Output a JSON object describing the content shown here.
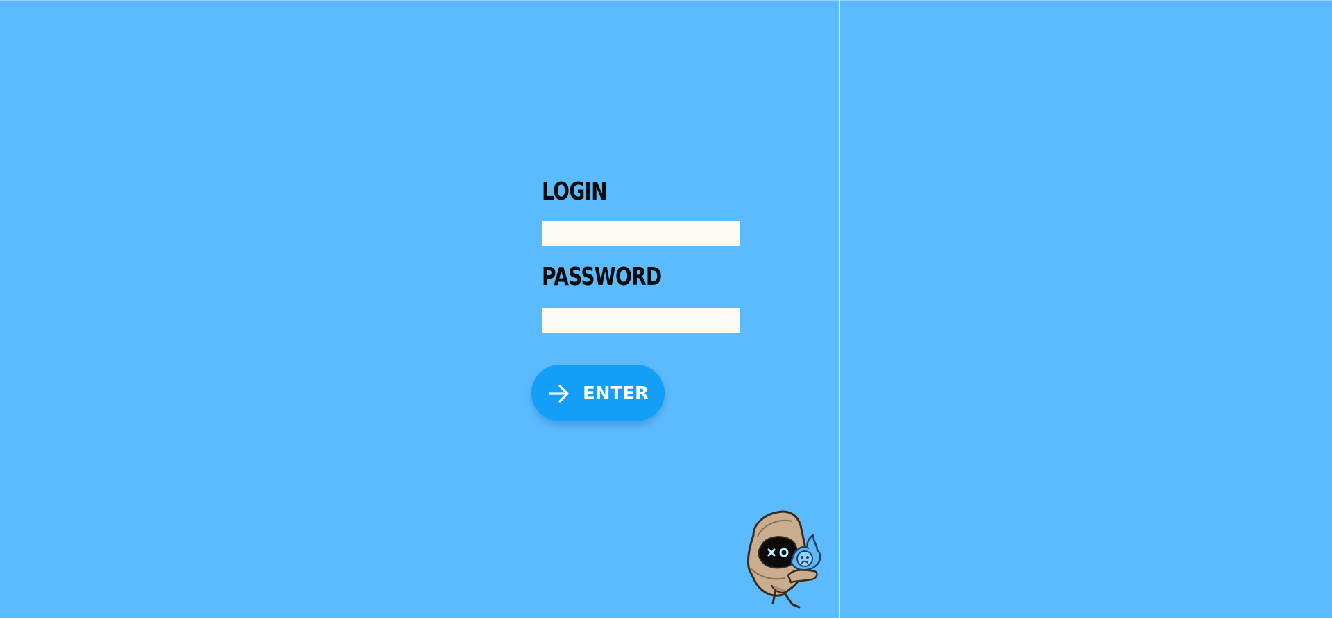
{
  "form": {
    "login_label": "LOGIN",
    "login_value": "",
    "password_label": "PASSWORD",
    "password_value": "",
    "enter_label": "ENTER",
    "enter_icon": "arrow-right-icon"
  },
  "mascot": {
    "icon": "hooded-character-icon"
  },
  "colors": {
    "background": "#5cbbfe",
    "button": "#139ef7",
    "field": "#fdf9f3",
    "label_text": "#0a0a0a"
  }
}
